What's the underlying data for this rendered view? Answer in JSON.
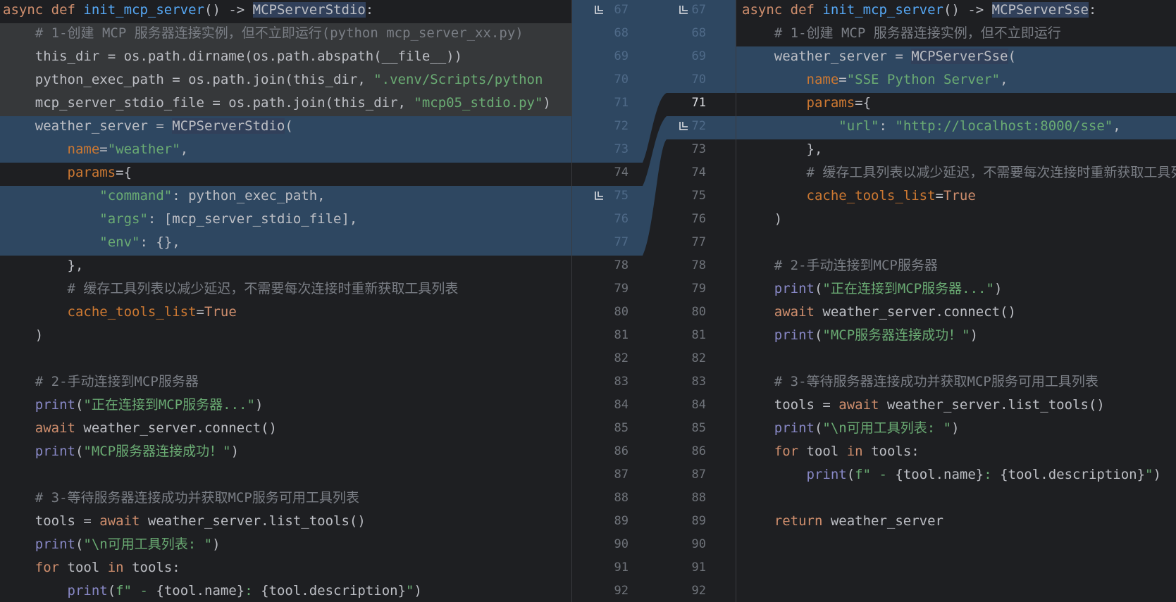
{
  "left": {
    "lines": [
      [
        "kw:async ",
        "kw:def ",
        "fn:init_mcp_server",
        "t:() -> ",
        "cls:MCPServerStdio",
        "t::"
      ],
      [
        "t:    ",
        "cm:# 1-创建 MCP 服务器连接实例，但不立即运行(python mcp_server_xx.py)"
      ],
      [
        "t:    this_dir = os.path.dirname(os.path.abspath(__file__))"
      ],
      [
        "t:    python_exec_path = os.path.join(this_dir, ",
        "str:\".venv/Scripts/python"
      ],
      [
        "t:    mcp_server_stdio_file = os.path.join(this_dir, ",
        "str:\"mcp05_stdio.py\"",
        "t:)"
      ],
      [
        "t:    weather_server = ",
        "cls:MCPServerStdio",
        "t:("
      ],
      [
        "t:        ",
        "pr:name",
        "t:=",
        "str:\"weather\"",
        "t:,"
      ],
      [
        "t:        ",
        "pr:params",
        "t:={"
      ],
      [
        "t:            ",
        "str:\"command\"",
        "t:: python_exec_path,"
      ],
      [
        "t:            ",
        "str:\"args\"",
        "t:: [mcp_server_stdio_file],"
      ],
      [
        "t:            ",
        "str:\"env\"",
        "t:: {},"
      ],
      [
        "t:        },"
      ],
      [
        "t:        ",
        "cm:# 缓存工具列表以减少延迟，不需要每次连接时重新获取工具列表"
      ],
      [
        "t:        ",
        "pr:cache_tools_list",
        "t:=",
        "kw:True"
      ],
      [
        "t:    )"
      ],
      [
        "t:"
      ],
      [
        "t:    ",
        "cm:# 2-手动连接到MCP服务器"
      ],
      [
        "t:    ",
        "bi:print",
        "t:(",
        "str:\"正在连接到MCP服务器...\"",
        "t:)"
      ],
      [
        "t:    ",
        "kw:await ",
        "t:weather_server.connect()"
      ],
      [
        "t:    ",
        "bi:print",
        "t:(",
        "str:\"MCP服务器连接成功！\"",
        "t:)"
      ],
      [
        "t:"
      ],
      [
        "t:    ",
        "cm:# 3-等待服务器连接成功并获取MCP服务可用工具列表"
      ],
      [
        "t:    tools = ",
        "kw:await ",
        "t:weather_server.list_tools()"
      ],
      [
        "t:    ",
        "bi:print",
        "t:(",
        "str:\"\\n可用工具列表: \"",
        "t:)"
      ],
      [
        "t:    ",
        "kw:for ",
        "t:tool ",
        "kw:in ",
        "t:tools:"
      ],
      [
        "t:        ",
        "bi:print",
        "t:(",
        "str:f\" - ",
        "t:{tool.name}",
        "str:: ",
        "t:{tool.description}",
        "str:\"",
        "t:)"
      ]
    ]
  },
  "right": {
    "lines": [
      [
        "kw:async ",
        "kw:def ",
        "fn:init_mcp_server",
        "t:() -> ",
        "cls:MCPServerSse",
        "t::"
      ],
      [
        "t:    ",
        "cm:# 1-创建 MCP 服务器连接实例，但不立即运行"
      ],
      [
        "t:    weather_server = ",
        "cls:MCPServerSse",
        "t:("
      ],
      [
        "t:        ",
        "pr:name",
        "t:=",
        "str:\"SSE Python Server\"",
        "t:,"
      ],
      [
        "t:        ",
        "pr:params",
        "t:={"
      ],
      [
        "t:            ",
        "str:\"url\"",
        "t:: ",
        "str:\"http://localhost:8000/sse\"",
        "t:,"
      ],
      [
        "t:        },"
      ],
      [
        "t:        ",
        "cm:# 缓存工具列表以减少延迟，不需要每次连接时重新获取工具列"
      ],
      [
        "t:        ",
        "pr:cache_tools_list",
        "t:=",
        "kw:True"
      ],
      [
        "t:    )"
      ],
      [
        "t:"
      ],
      [
        "t:    ",
        "cm:# 2-手动连接到MCP服务器"
      ],
      [
        "t:    ",
        "bi:print",
        "t:(",
        "str:\"正在连接到MCP服务器...\"",
        "t:)"
      ],
      [
        "t:    ",
        "kw:await ",
        "t:weather_server.connect()"
      ],
      [
        "t:    ",
        "bi:print",
        "t:(",
        "str:\"MCP服务器连接成功！\"",
        "t:)"
      ],
      [
        "t:"
      ],
      [
        "t:    ",
        "cm:# 3-等待服务器连接成功并获取MCP服务可用工具列表"
      ],
      [
        "t:    tools = ",
        "kw:await ",
        "t:weather_server.list_tools()"
      ],
      [
        "t:    ",
        "bi:print",
        "t:(",
        "str:\"\\n可用工具列表: \"",
        "t:)"
      ],
      [
        "t:    ",
        "kw:for ",
        "t:tool ",
        "kw:in ",
        "t:tools:"
      ],
      [
        "t:        ",
        "bi:print",
        "t:(",
        "str:f\" - ",
        "t:{tool.name}",
        "str:: ",
        "t:{tool.description}",
        "str:\"",
        "t:)"
      ],
      [
        "t:"
      ],
      [
        "t:    ",
        "kw:return ",
        "t:weather_server"
      ],
      [
        "t:"
      ],
      [
        "t:"
      ],
      [
        "t:"
      ]
    ]
  },
  "gutter": {
    "left_numbers": [
      "67",
      "68",
      "69",
      "70",
      "71",
      "72",
      "73",
      "74",
      "75",
      "76",
      "77",
      "78",
      "79",
      "80",
      "81",
      "82",
      "83",
      "84",
      "85",
      "86",
      "87",
      "88",
      "89",
      "90",
      "91",
      "92"
    ],
    "right_numbers": [
      "67",
      "68",
      "69",
      "70",
      "71",
      "72",
      "73",
      "74",
      "75",
      "76",
      "77",
      "78",
      "79",
      "80",
      "81",
      "82",
      "83",
      "84",
      "85",
      "86",
      "87",
      "88",
      "89",
      "90",
      "91",
      "92"
    ],
    "current_line": "71",
    "marker_icon": "merge-arrow-icon"
  }
}
